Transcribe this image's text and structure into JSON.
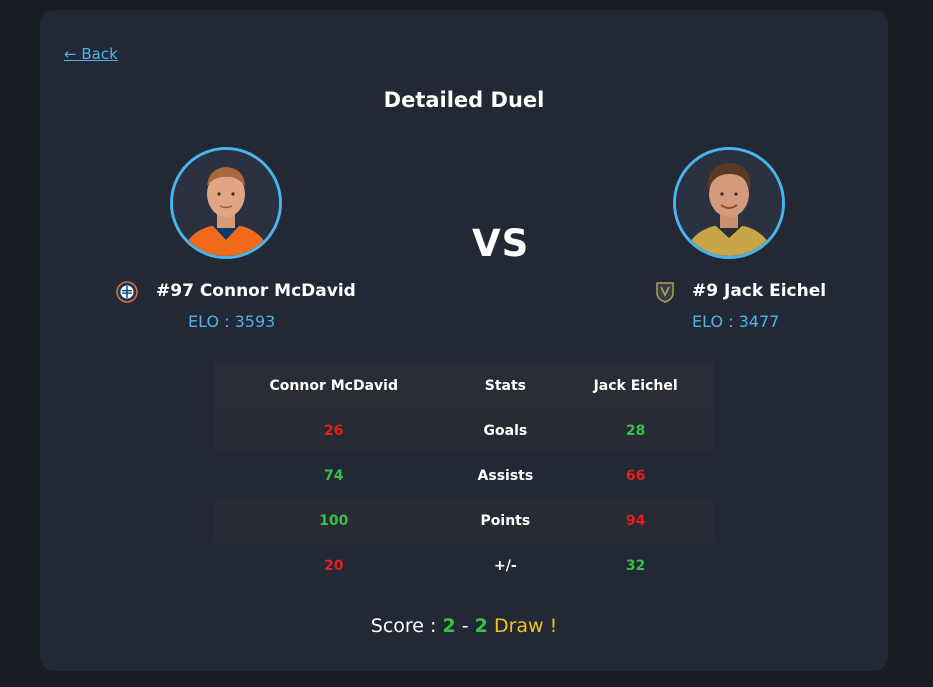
{
  "nav": {
    "back_label": "← Back"
  },
  "page": {
    "title": "Detailed Duel",
    "vs_label": "VS"
  },
  "players": {
    "left": {
      "name": "#97 Connor McDavid",
      "elo": "ELO : 3593",
      "team_logo": "oilers-logo-icon",
      "jersey_color": "#f26b1d",
      "team_color": "#0c3b6b"
    },
    "right": {
      "name": "#9 Jack Eichel",
      "elo": "ELO : 3477",
      "team_logo": "golden-knights-logo-icon",
      "jersey_color": "#b9975b",
      "team_color": "#333f48"
    }
  },
  "table": {
    "headers": [
      "Connor McDavid",
      "Stats",
      "Jack Eichel"
    ],
    "rows": [
      {
        "left": "26",
        "stat": "Goals",
        "right": "28",
        "left_status": "lose",
        "right_status": "win"
      },
      {
        "left": "74",
        "stat": "Assists",
        "right": "66",
        "left_status": "win",
        "right_status": "lose"
      },
      {
        "left": "100",
        "stat": "Points",
        "right": "94",
        "left_status": "win",
        "right_status": "lose"
      },
      {
        "left": "20",
        "stat": "+/-",
        "right": "32",
        "left_status": "lose",
        "right_status": "win"
      }
    ]
  },
  "score": {
    "label": "Score :",
    "left": "2",
    "separator": "-",
    "right": "2",
    "result": "Draw !"
  },
  "colors": {
    "accent": "#4fb3ea",
    "win": "#35c245",
    "lose": "#e51d1d",
    "draw": "#f2c31b",
    "card_bg": "#222834"
  }
}
